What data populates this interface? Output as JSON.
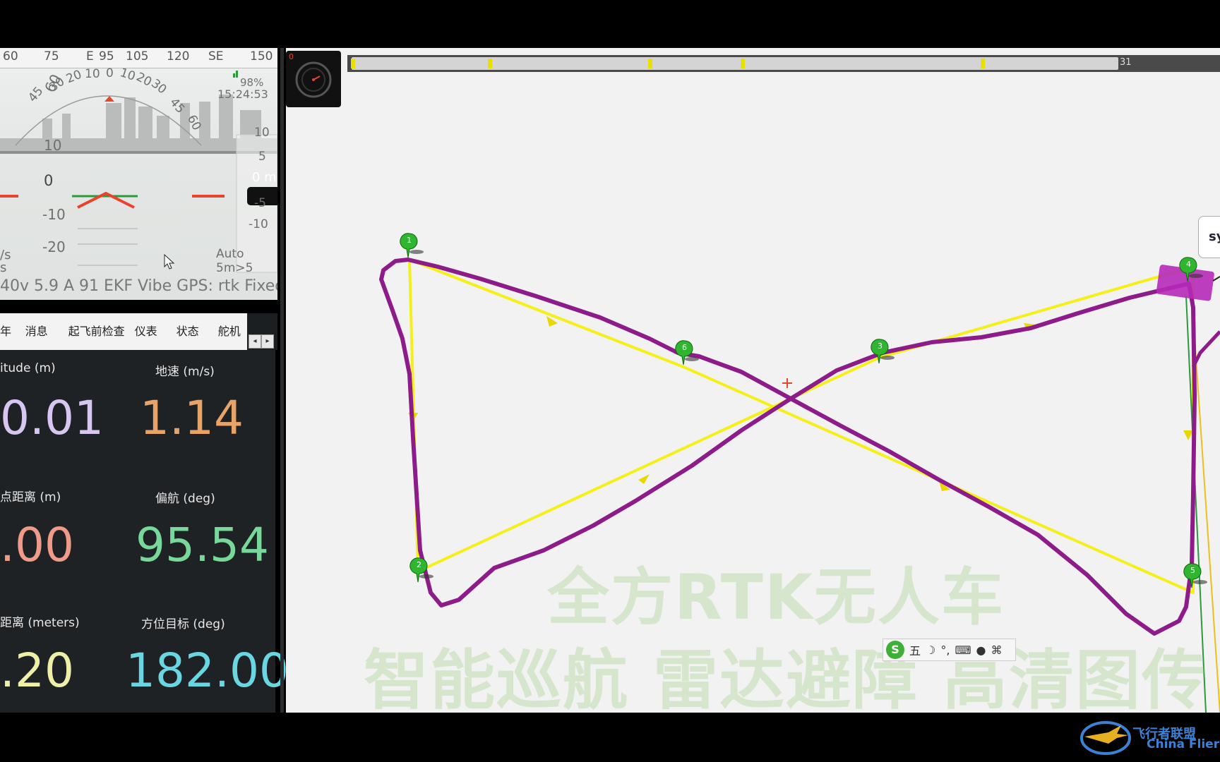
{
  "hud": {
    "compass_ticks": [
      "60",
      "75",
      "E",
      "95",
      "105",
      "120",
      "SE",
      "150"
    ],
    "heading_arc": [
      "60",
      "45",
      "30",
      "20",
      "10",
      "0",
      "10",
      "20",
      "30",
      "45",
      "60"
    ],
    "pitch": {
      "plus10": "10",
      "zero": "0",
      "minus10": "-10",
      "minus20": "-20"
    },
    "alt_scale": [
      "10",
      "5",
      "-5",
      "-10"
    ],
    "alt_readout": "0 m",
    "battery_pct": "98%",
    "time": "15:24:53",
    "left_units_1": "/s",
    "left_units_2": "s",
    "mode": "Auto",
    "sat_info": "5m>5",
    "status_line": "40v 5.9 A 91 EKF   Vibe  GPS: rtk Fixed"
  },
  "tabs": {
    "items": [
      "年",
      "消息",
      "起飞前检查",
      "仪表",
      "状态",
      "舵机"
    ],
    "scroll_left": "◂",
    "scroll_right": "▸"
  },
  "quick": {
    "cells": [
      {
        "label": "itude (m)",
        "value": "0.01",
        "color": "#d8c6f2"
      },
      {
        "label": "地速 (m/s)",
        "value": "1.14",
        "color": "#e8a468"
      },
      {
        "label": "点距离 (m)",
        "value": ".00",
        "color": "#f09a8a"
      },
      {
        "label": "偏航 (deg)",
        "value": "95.54",
        "color": "#78d89a"
      },
      {
        "label": "距离 (meters)",
        "value": ".20",
        "color": "#eef0a8"
      },
      {
        "label": "方位目标 (deg)",
        "value": "182.00",
        "color": "#6ad6e2"
      }
    ]
  },
  "map": {
    "timeline_start": "0",
    "timeline_end": "31",
    "waypoints": [
      "1",
      "2",
      "3",
      "4",
      "5",
      "6"
    ],
    "vehicle_bubble": "sy",
    "watermark_line1": "全方RTK无人车",
    "watermark_line2": "智能巡航 雷达避障 高清图传",
    "ime_items": [
      "S",
      "五",
      "☽",
      "°,",
      "⌨",
      "●",
      "⌘"
    ]
  },
  "logo": {
    "cn": "飞行者联盟",
    "en": "China Flier"
  },
  "colors": {
    "route_planned": "#f5ef1a",
    "route_actual": "#8e1b8a",
    "waypoint": "#2fb52f",
    "vehicle": "#b62ab8"
  }
}
